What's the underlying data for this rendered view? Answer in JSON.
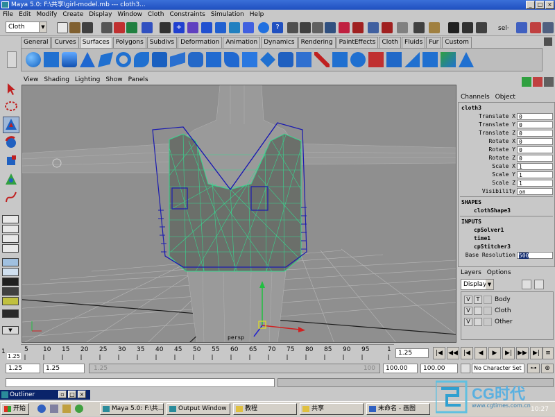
{
  "window": {
    "title": "Maya 5.0: F:\\共享\\girl-model.mb   ---   cloth3...",
    "min": "_",
    "max": "□",
    "close": "×"
  },
  "menubar": [
    "File",
    "Edit",
    "Modify",
    "Create",
    "Display",
    "Window",
    "Cloth",
    "Constraints",
    "Simulation",
    "Help"
  ],
  "status": {
    "mode": "Cloth",
    "sel_label": "sel·"
  },
  "shelf_tabs": [
    "General",
    "Curves",
    "Surfaces",
    "Polygons",
    "Subdivs",
    "Deformation",
    "Animation",
    "Dynamics",
    "Rendering",
    "PaintEffects",
    "Cloth",
    "Fluids",
    "Fur",
    "Custom"
  ],
  "shelf_active": "Surfaces",
  "viewport": {
    "menu": [
      "View",
      "Shading",
      "Lighting",
      "Show",
      "Panels"
    ],
    "camera": "persp"
  },
  "channels": {
    "menu": [
      "Channels",
      "Object"
    ],
    "node": "cloth3",
    "attrs": [
      {
        "label": "Translate X",
        "value": "0"
      },
      {
        "label": "Translate Y",
        "value": "0"
      },
      {
        "label": "Translate Z",
        "value": "0"
      },
      {
        "label": "Rotate X",
        "value": "0"
      },
      {
        "label": "Rotate Y",
        "value": "0"
      },
      {
        "label": "Rotate Z",
        "value": "0"
      },
      {
        "label": "Scale X",
        "value": "1"
      },
      {
        "label": "Scale Y",
        "value": "1"
      },
      {
        "label": "Scale Z",
        "value": "1"
      },
      {
        "label": "Visibility",
        "value": "on"
      }
    ],
    "shapes_title": "SHAPES",
    "shape": "clothShape3",
    "inputs_title": "INPUTS",
    "inputs": [
      "cpSolver1",
      "time1",
      "cpStitcher3"
    ],
    "base_res_label": "Base Resolution",
    "base_res_value": "500"
  },
  "layers": {
    "menu": [
      "Layers",
      "Options"
    ],
    "dropdown": "Display",
    "items": [
      {
        "v": "V",
        "t": "T",
        "name": "Body"
      },
      {
        "v": "V",
        "t": "",
        "name": "Cloth"
      },
      {
        "v": "V",
        "t": "",
        "name": "Other"
      }
    ]
  },
  "timeline": {
    "ticks": [
      "5",
      "10",
      "15",
      "20",
      "25",
      "30",
      "35",
      "40",
      "45",
      "50",
      "55",
      "60",
      "65",
      "70",
      "75",
      "80",
      "85",
      "90",
      "95",
      "1"
    ],
    "start_marker": "1",
    "start_sub": "1.25",
    "current": "1.25"
  },
  "range": {
    "start": "1.25",
    "inner_start": "1.25",
    "inner_left": "1.25",
    "inner_end": "100",
    "end": "100.00",
    "end2": "100.00",
    "charset": "No Character Set"
  },
  "outliner": {
    "title": "Outliner"
  },
  "taskbar": {
    "start": "开始",
    "tasks": [
      "Maya 5.0: F:\\共...",
      "Output Window",
      "教程",
      "共享",
      "未命名 - 画图"
    ],
    "clock": "10:27"
  },
  "watermark": {
    "text": "CG时代",
    "sub": "www.cgtimes.com.cn"
  },
  "colors": {
    "mesh": "#38d890",
    "cage": "#1a1ab0",
    "grid": "#b8b8b8",
    "bg": "#8f8f8f"
  }
}
